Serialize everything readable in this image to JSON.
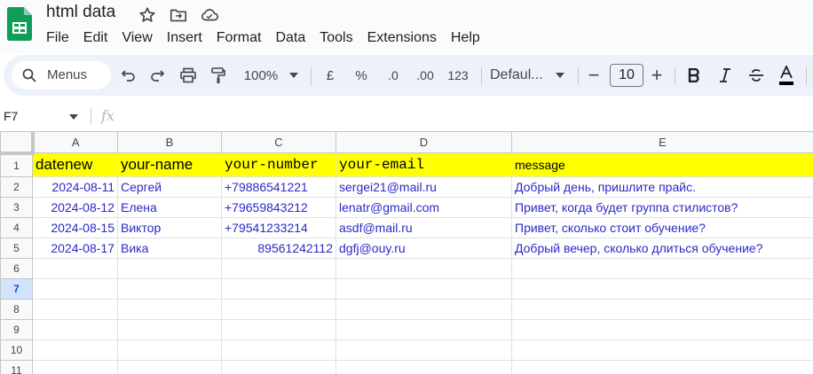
{
  "app": {
    "title": "html data",
    "menus": [
      "File",
      "Edit",
      "View",
      "Insert",
      "Format",
      "Data",
      "Tools",
      "Extensions",
      "Help"
    ],
    "title_icons": [
      "star-icon",
      "move-to-folder-icon",
      "cloud-status-icon"
    ]
  },
  "toolbar": {
    "search_label": "Menus",
    "zoom": "100%",
    "currency": "£",
    "percent": "%",
    "decimal_decrease": ".0",
    "decimal_increase": ".00",
    "number_format": "123",
    "font_family": "Defaul...",
    "font_size": "10",
    "minus": "−",
    "plus": "+"
  },
  "formula_bar": {
    "name_box": "F7",
    "fx": "fx",
    "formula": ""
  },
  "sheet": {
    "columns": [
      "A",
      "B",
      "C",
      "D",
      "E"
    ],
    "row_numbers": [
      "1",
      "2",
      "3",
      "4",
      "5",
      "6",
      "7",
      "8",
      "9",
      "10",
      "11"
    ],
    "selected_row": "7",
    "header_row": [
      "datenew",
      "your-name",
      "your-number",
      "your-email",
      "message"
    ],
    "rows": [
      [
        "2024-08-11",
        "Сергей",
        "+79886541221",
        "sergei21@mail.ru",
        "Добрый день, пришлите прайс."
      ],
      [
        "2024-08-12",
        "Елена",
        "+79659843212",
        "lenatr@gmail.com",
        "Привет, когда будет группа стилистов?"
      ],
      [
        "2024-08-15",
        "Виктор",
        "+79541233214",
        "asdf@mail.ru",
        "Привет, сколько стоит обучение?"
      ],
      [
        "2024-08-17",
        "Вика",
        "89561242112",
        "dgfj@ouy.ru",
        "Добрый вечер, сколько длиться обучение?"
      ]
    ]
  },
  "colors": {
    "header_fill": "#ffff00",
    "data_text": "#2a2ac6",
    "sheets_green": "#0f9d58"
  }
}
